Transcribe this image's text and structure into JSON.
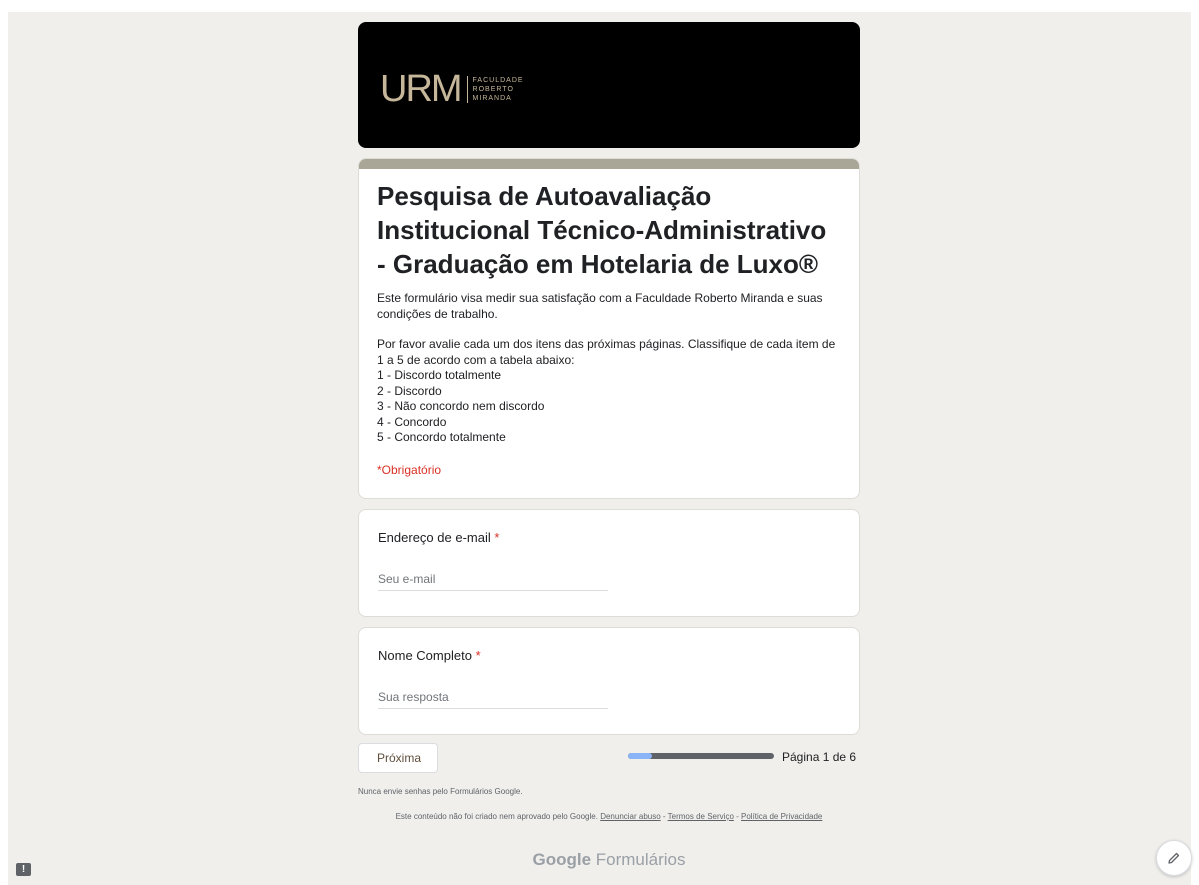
{
  "banner": {
    "logo_mark": "URM",
    "logo_lines": [
      "FACULDADE",
      "ROBERTO",
      "MIRANDA"
    ]
  },
  "form": {
    "title": "Pesquisa de Autoavaliação Institucional Técnico-Administrativo - Graduação em Hotelaria de Luxo®",
    "description_1": "Este formulário visa medir sua satisfação com a Faculdade Roberto Miranda e suas condições de trabalho.",
    "description_2": "Por favor avalie cada um dos itens das próximas páginas. Classifique de cada item de 1 a 5 de acordo com a tabela abaixo:\n1 - Discordo totalmente\n2 - Discordo\n3 - Não concordo nem discordo\n4 - Concordo\n5 - Concordo totalmente",
    "required_note": "*Obrigatório"
  },
  "questions": [
    {
      "label": "Endereço de e-mail",
      "required_mark": "*",
      "placeholder": "Seu e-mail",
      "value": ""
    },
    {
      "label": "Nome Completo",
      "required_mark": "*",
      "placeholder": "Sua resposta",
      "value": ""
    }
  ],
  "navigation": {
    "next_label": "Próxima",
    "page_indicator": "Página 1 de 6",
    "progress_fraction": 0.167
  },
  "footer": {
    "password_note": "Nunca envie senhas pelo Formulários Google.",
    "legal_prefix": "Este conteúdo não foi criado nem aprovado pelo Google.",
    "report_abuse": "Denunciar abuso",
    "terms": "Termos de Serviço",
    "privacy": "Política de Privacidade",
    "brand_bold": "Google",
    "brand_rest": "Formulários"
  },
  "icons": {
    "feedback": "feedback-icon",
    "edit": "pencil-icon"
  },
  "colors": {
    "background": "#f0efec",
    "accent_bar": "#a9a597",
    "required": "#d93025",
    "progress_fill": "#8ab4f8"
  }
}
